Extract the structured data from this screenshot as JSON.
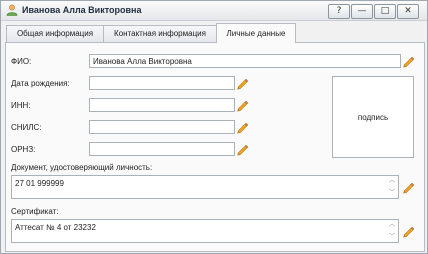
{
  "window": {
    "title": "Иванова Алла Викторовна",
    "buttons": {
      "help": "?",
      "minimize": "—",
      "maximize": "□",
      "close": "✕"
    }
  },
  "tabs": [
    {
      "label": "Общая информация",
      "active": false
    },
    {
      "label": "Контактная информация",
      "active": false
    },
    {
      "label": "Личные данные",
      "active": true
    }
  ],
  "form": {
    "fio": {
      "label": "ФИО:",
      "value": "Иванова Алла Викторовна"
    },
    "birth_date": {
      "label": "Дата рождения:",
      "value": ""
    },
    "inn": {
      "label": "ИНН:",
      "value": ""
    },
    "snils": {
      "label": "СНИЛС:",
      "value": ""
    },
    "orpz": {
      "label": "ОРНЗ:",
      "value": ""
    },
    "signature": {
      "label": "подпись"
    },
    "document": {
      "label": "Документ, удостоверяющий личность:",
      "value": "27 01 999999"
    },
    "certificate": {
      "label": "Сертификат:",
      "value": "Аттесат № 4 от 23232"
    }
  },
  "icons": {
    "window": "user-icon",
    "edit": "pencil-icon",
    "scroll_up": "scroll-up-icon",
    "scroll_down": "scroll-down-icon"
  },
  "colors": {
    "pencil_body": "#f0a020",
    "pencil_tip": "#c8862a",
    "border": "#a9b1ba",
    "title_bar": "#e4e6e9"
  }
}
